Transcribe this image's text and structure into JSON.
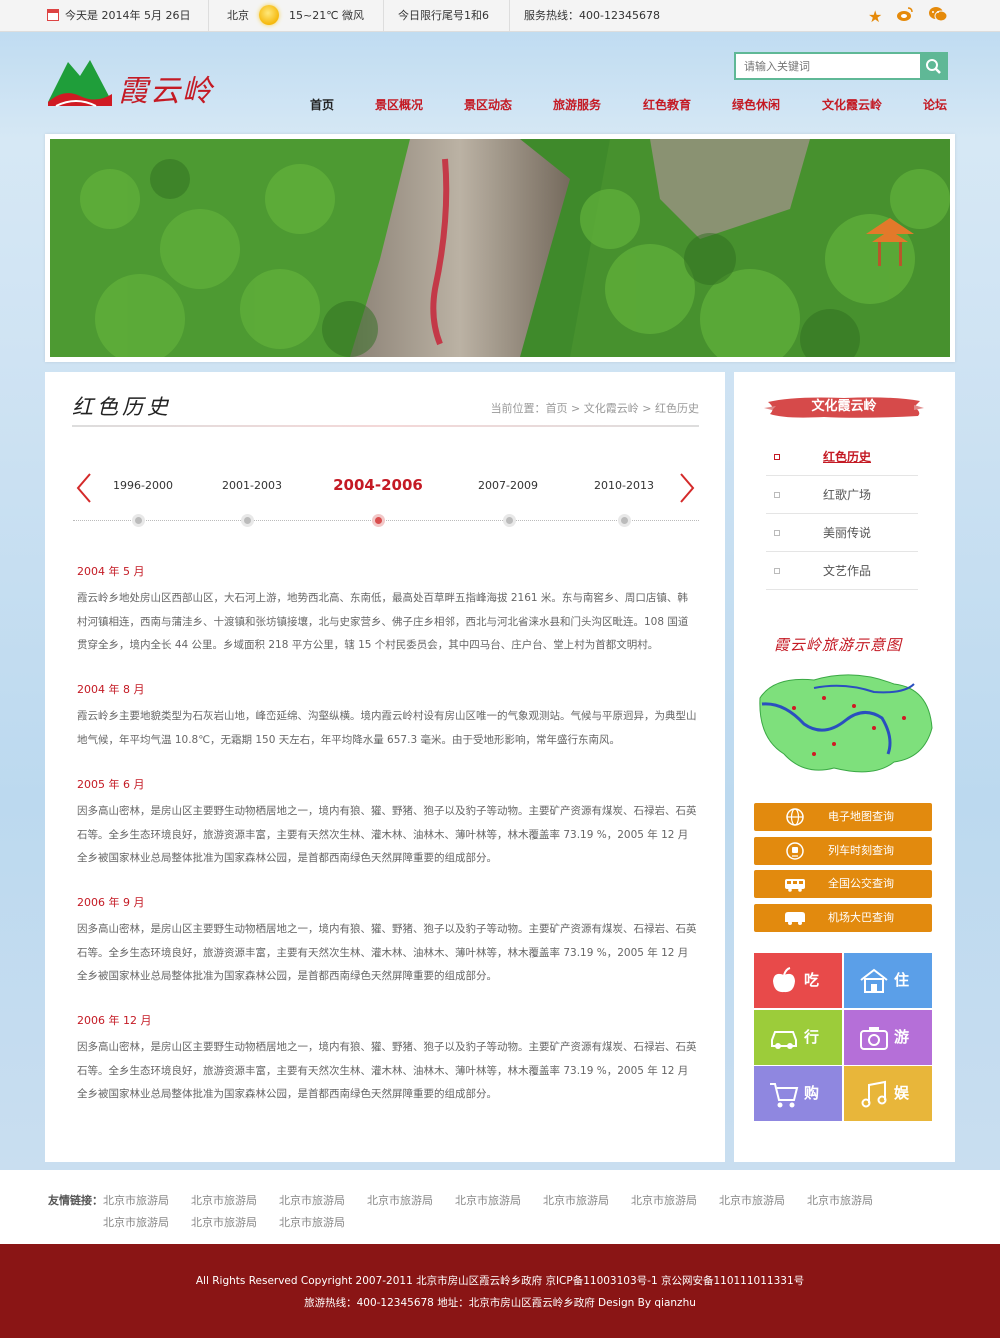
{
  "topbar": {
    "date": "今天是 2014年 5月 26日",
    "city": "北京",
    "weather": "15~21℃ 微风",
    "traffic_limit": "今日限行尾号1和6",
    "hotline": "服务热线：400-12345678",
    "icons": [
      "star-icon",
      "weibo-icon",
      "wechat-icon"
    ]
  },
  "header": {
    "logo_text": "霞云岭",
    "search_placeholder": "请输入关键词"
  },
  "nav": [
    {
      "label": "首页",
      "active": true
    },
    {
      "label": "景区概况"
    },
    {
      "label": "景区动态"
    },
    {
      "label": "旅游服务"
    },
    {
      "label": "红色教育"
    },
    {
      "label": "绿色休闲"
    },
    {
      "label": "文化霞云岭"
    },
    {
      "label": "论坛"
    }
  ],
  "main": {
    "section_title": "红色历史",
    "breadcrumb": {
      "prefix": "当前位置：",
      "home": "首页",
      "sep1": " > ",
      "parent": "文化霞云岭",
      "sep2": " > ",
      "current": "红色历史"
    },
    "timeline": [
      {
        "label": "1996-2000"
      },
      {
        "label": "2001-2003"
      },
      {
        "label": "2004-2006",
        "active": true
      },
      {
        "label": "2007-2009"
      },
      {
        "label": "2010-2013"
      }
    ],
    "entries": [
      {
        "date": "2004 年 5 月",
        "text": "霞云岭乡地处房山区西部山区，大石河上游，地势西北高、东南低，最高处百草畔五指峰海拔 2161 米。东与南窖乡、周口店镇、韩村河镇相连，西南与蒲洼乡、十渡镇和张坊镇接壤，北与史家营乡、佛子庄乡相邻，西北与河北省涞水县和门头沟区毗连。108 国道贯穿全乡，境内全长 44 公里。乡域面积 218 平方公里，辖 15 个村民委员会，其中四马台、庄户台、堂上村为首都文明村。"
      },
      {
        "date": "2004 年 8 月",
        "text": "霞云岭乡主要地貌类型为石灰岩山地，峰峦延绵、沟壑纵横。境内霞云岭村设有房山区唯一的气象观测站。气候与平原迥异，为典型山地气候，年平均气温 10.8℃，无霜期 150 天左右，年平均降水量 657.3 毫米。由于受地形影响，常年盛行东南风。"
      },
      {
        "date": "2005 年 6 月",
        "text": "因多高山密林，是房山区主要野生动物栖居地之一，境内有狼、獾、野猪、狍子以及豹子等动物。主要矿产资源有煤炭、石禄岩、石英石等。全乡生态环境良好，旅游资源丰富，主要有天然次生林、灌木林、油林木、薄叶林等，林木覆盖率 73.19 %，2005 年 12 月全乡被国家林业总局整体批准为国家森林公园，是首都西南绿色天然屏障重要的组成部分。"
      },
      {
        "date": "2006 年 9 月",
        "text": "因多高山密林，是房山区主要野生动物栖居地之一，境内有狼、獾、野猪、狍子以及豹子等动物。主要矿产资源有煤炭、石禄岩、石英石等。全乡生态环境良好，旅游资源丰富，主要有天然次生林、灌木林、油林木、薄叶林等，林木覆盖率 73.19 %，2005 年 12 月全乡被国家林业总局整体批准为国家森林公园，是首都西南绿色天然屏障重要的组成部分。"
      },
      {
        "date": "2006 年 12 月",
        "text": "因多高山密林，是房山区主要野生动物栖居地之一，境内有狼、獾、野猪、狍子以及豹子等动物。主要矿产资源有煤炭、石禄岩、石英石等。全乡生态环境良好，旅游资源丰富，主要有天然次生林、灌木林、油林木、薄叶林等，林木覆盖率 73.19 %，2005 年 12 月全乡被国家林业总局整体批准为国家森林公园，是首都西南绿色天然屏障重要的组成部分。"
      }
    ]
  },
  "sidebar": {
    "ribbon": "文化霞云岭",
    "menu": [
      {
        "label": "红色历史",
        "active": true
      },
      {
        "label": "红歌广场"
      },
      {
        "label": "美丽传说"
      },
      {
        "label": "文艺作品"
      }
    ],
    "map_title": "霞云岭旅游示意图",
    "queries": [
      {
        "label": "电子地图查询",
        "icon": "globe-icon"
      },
      {
        "label": "列车时刻查询",
        "icon": "train-icon"
      },
      {
        "label": "全国公交查询",
        "icon": "bus-icon"
      },
      {
        "label": "机场大巴查询",
        "icon": "coach-icon"
      }
    ],
    "tiles": [
      {
        "label": "吃",
        "icon": "apple-icon",
        "color": "#e84a4a"
      },
      {
        "label": "住",
        "icon": "house-icon",
        "color": "#5b9fe8"
      },
      {
        "label": "行",
        "icon": "car-icon",
        "color": "#9ccc3a"
      },
      {
        "label": "游",
        "icon": "camera-icon",
        "color": "#b56fd8"
      },
      {
        "label": "购",
        "icon": "cart-icon",
        "color": "#8f87e0"
      },
      {
        "label": "娱",
        "icon": "music-icon",
        "color": "#e8b63a"
      }
    ]
  },
  "friend_links": {
    "label": "友情链接：",
    "links": [
      "北京市旅游局",
      "北京市旅游局",
      "北京市旅游局",
      "北京市旅游局",
      "北京市旅游局",
      "北京市旅游局",
      "北京市旅游局",
      "北京市旅游局",
      "北京市旅游局",
      "北京市旅游局",
      "北京市旅游局",
      "北京市旅游局"
    ]
  },
  "footer": {
    "line1": "All Rights Reserved Copyright 2007-2011  北京市房山区霞云岭乡政府   京ICP备11003103号-1   京公网安备110111011331号",
    "line2": "旅游热线：400-12345678   地址：北京市房山区霞云岭乡政府   Design By qianzhu"
  },
  "colors": {
    "brand_red": "#c41a24",
    "accent_green": "#5fb896",
    "button_orange": "#e28a0e",
    "footer_bg": "#8a1515"
  }
}
